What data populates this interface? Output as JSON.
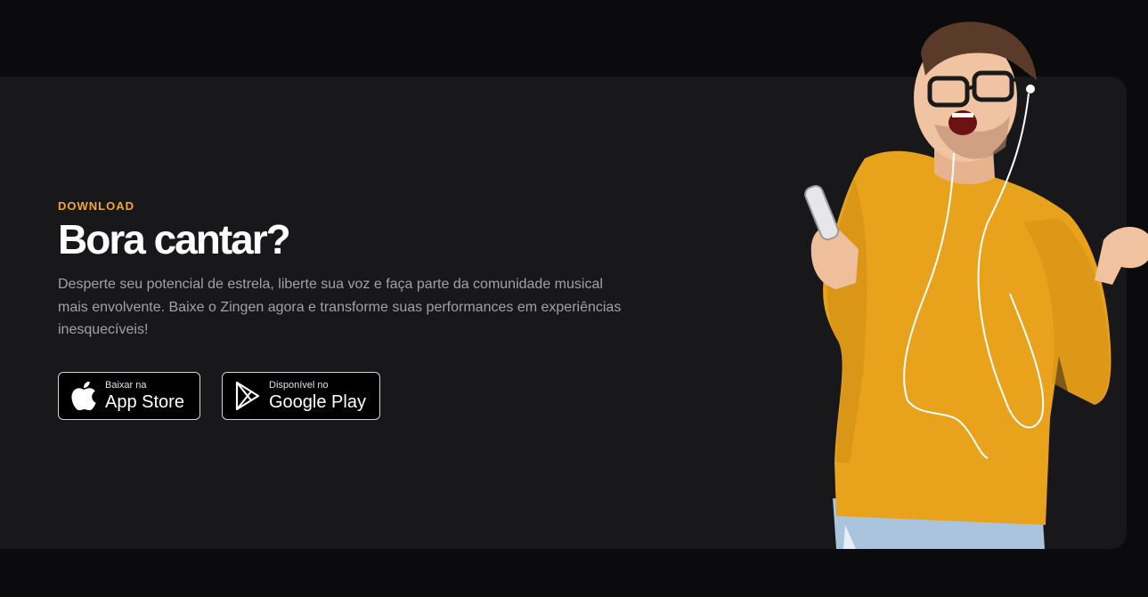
{
  "section": {
    "eyebrow": "DOWNLOAD",
    "title": "Bora cantar?",
    "description": "Desperte seu potencial de estrela, liberte sua voz e faça parte da comunidade musical mais envolvente. Baixe o Zingen agora e transforme suas performances em experiências inesquecíveis!"
  },
  "stores": {
    "apple": {
      "small": "Baixar na",
      "big": "App Store",
      "icon": "apple-icon"
    },
    "google": {
      "small": "Disponível no",
      "big": "Google Play",
      "icon": "google-play-icon"
    }
  },
  "colors": {
    "accent": "#f5a623",
    "background": "#0b0b0d",
    "card": "#18181b",
    "sweater": "#e8a21c"
  }
}
